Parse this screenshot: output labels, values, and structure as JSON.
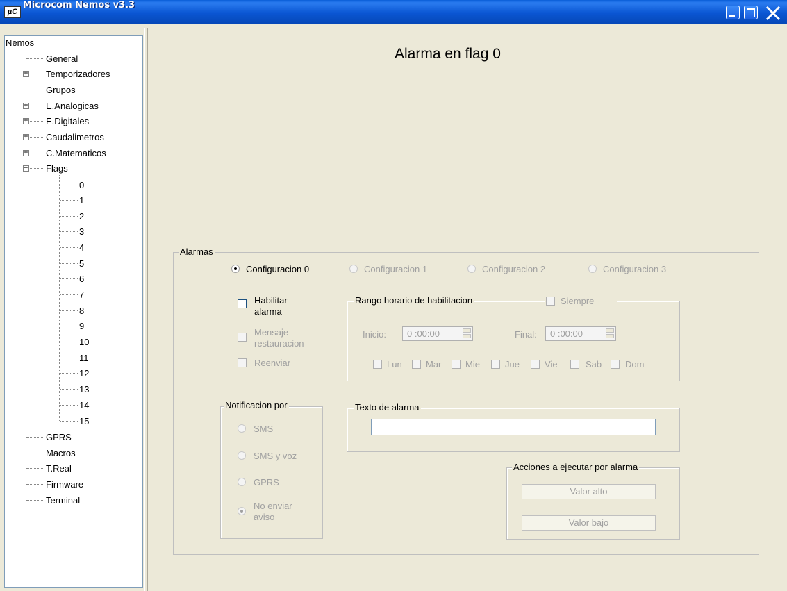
{
  "window": {
    "title": "Microcom Nemos v3.3",
    "icon": "app-logo-icon"
  },
  "tree": {
    "root": "Nemos",
    "items": [
      "General",
      "Temporizadores",
      "Grupos",
      "E.Analogicas",
      "E.Digitales",
      "Caudalimetros",
      "C.Matematicos",
      "Flags"
    ],
    "flags": [
      "0",
      "1",
      "2",
      "3",
      "4",
      "5",
      "6",
      "7",
      "8",
      "9",
      "10",
      "11",
      "12",
      "13",
      "14",
      "15"
    ],
    "after": [
      "GPRS",
      "Macros",
      "T.Real",
      "Firmware",
      "Terminal"
    ]
  },
  "main": {
    "title": "Alarma en flag  0",
    "alarmas": {
      "legend": "Alarmas",
      "configs": [
        "Configuracion 0",
        "Configuracion 1",
        "Configuracion 2",
        "Configuracion 3"
      ],
      "selected_config": "Configuracion 0",
      "habilitar": [
        "Habilitar",
        "alarma"
      ],
      "mensaje": [
        "Mensaje",
        "restauracion"
      ],
      "reenviar": "Reenviar",
      "rango": {
        "legend": "Rango horario de habilitacion",
        "siempre": "Siempre",
        "inicio_label": "Inicio:",
        "inicio_value": "0 :00:00",
        "final_label": "Final:",
        "final_value": "0 :00:00",
        "days": [
          "Lun",
          "Mar",
          "Mie",
          "Jue",
          "Vie",
          "Sab",
          "Dom"
        ]
      },
      "notificacion": {
        "legend": "Notificacion por",
        "options": [
          "SMS",
          "SMS y voz",
          "GPRS"
        ],
        "no_enviar": [
          "No enviar",
          "aviso"
        ],
        "selected": "No enviar aviso"
      },
      "texto": {
        "legend": "Texto de alarma",
        "value": ""
      },
      "acciones": {
        "legend": "Acciones a ejecutar por alarma",
        "valor_alto": "Valor alto",
        "valor_bajo": "Valor bajo"
      }
    }
  }
}
